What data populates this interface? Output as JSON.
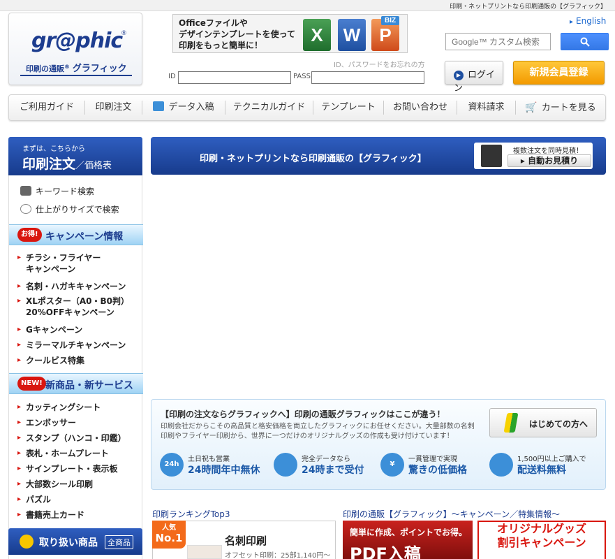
{
  "header": {
    "tagline": "印刷・ネットプリントなら印刷通販の【グラフィック】",
    "logo_text": "gr@phic",
    "logo_reg": "®",
    "logo_sub_small": "印刷の通販",
    "logo_sub_reg": "®",
    "logo_sub_big": "グラフィック",
    "banner_text": "Officeファイルや\nデザインテンプレートを使って\n印刷をもっと簡単に！",
    "banner_biz": "BIZ",
    "banner_apps": [
      "X",
      "W",
      "P"
    ],
    "forgot_text": "ID、パスワードをお忘れの方",
    "id_label": "ID",
    "pass_label": "PASS",
    "english_link": "English",
    "search_placeholder": "Google™ カスタム検索",
    "login_label": "ログイン",
    "register_label": "新規会員登録"
  },
  "nav": {
    "items": [
      "ご利用ガイド",
      "印刷注文",
      "データ入稿",
      "テクニカルガイド",
      "テンプレート",
      "お問い合わせ",
      "資料請求",
      "カートを見る"
    ]
  },
  "sidebar": {
    "head_small": "まずは、こちらから",
    "head_big": "印刷注文",
    "head_rest": "／価格表",
    "tools": [
      "キーワード検索",
      "仕上がりサイズで検索"
    ],
    "campaign": {
      "badge": "お得!",
      "label": "キャンペーン情報",
      "links": [
        "チラシ・フライヤー\nキャンペーン",
        "名刺・ハガキキャンペーン",
        "XLポスター（A0・B0判）\n20%OFFキャンペーン",
        "Gキャンペーン",
        "ミラーマルチキャンペーン",
        "クールビス特集"
      ]
    },
    "new": {
      "badge": "NEW!",
      "label": "新商品・新サービス",
      "links": [
        "カッティングシート",
        "エンボッサー",
        "スタンプ（ハンコ・印鑑）",
        "表札・ホームプレート",
        "サインプレート・表示板",
        "大部数シール印刷",
        "パズル",
        "書籍売上カード"
      ]
    },
    "goods_label": "取り扱い商品",
    "goods_all": "全商品"
  },
  "main": {
    "banner_title": "印刷・ネットプリントなら印刷通販の【グラフィック】",
    "auto_small": "複数注文を同時見積！",
    "auto_btn": "▸ 自動お見積り",
    "diff_title": "【印刷の注文ならグラフィックへ】印刷の通販グラフィックはここが違う！",
    "diff_desc": "印刷会社だからこその高品質と格安価格を両立したグラフィックにお任せください。大量部数の名刺印刷やフライヤー印刷から、世界に一つだけのオリジナルグッズの作成も受け付けています！",
    "first_btn": "はじめての方へ",
    "features": [
      {
        "icon": "24h",
        "small": "土日祝も営業",
        "big": "24時間年中無休"
      },
      {
        "icon": "",
        "small": "完全データなら",
        "big": "24時まで受付"
      },
      {
        "icon": "¥",
        "small": "一貫管理で実現",
        "big": "驚きの低価格"
      },
      {
        "icon": "",
        "small": "1,500円以上ご購入で",
        "big": "配送料無料"
      }
    ],
    "ranking_title": "印刷ランキングTop3",
    "rank_badge_top": "人気",
    "rank_badge_num": "No.1",
    "rank_name": "名刺印刷",
    "rank_price": "オフセット印刷：25部1,140円〜",
    "campaign_title": "印刷の通販【グラフィック】〜キャンペーン／特集情報〜",
    "pdf_small": "簡単に作成、ポイントでお得。",
    "pdf_big": "PDF入稿",
    "goods_line1": "オリジナルグッズ",
    "goods_line2": "割引キャンペーン"
  },
  "colors": {
    "brand_blue": "#1d3d8f",
    "register_orange": "#f39a00",
    "accent_red": "#d9160f"
  }
}
